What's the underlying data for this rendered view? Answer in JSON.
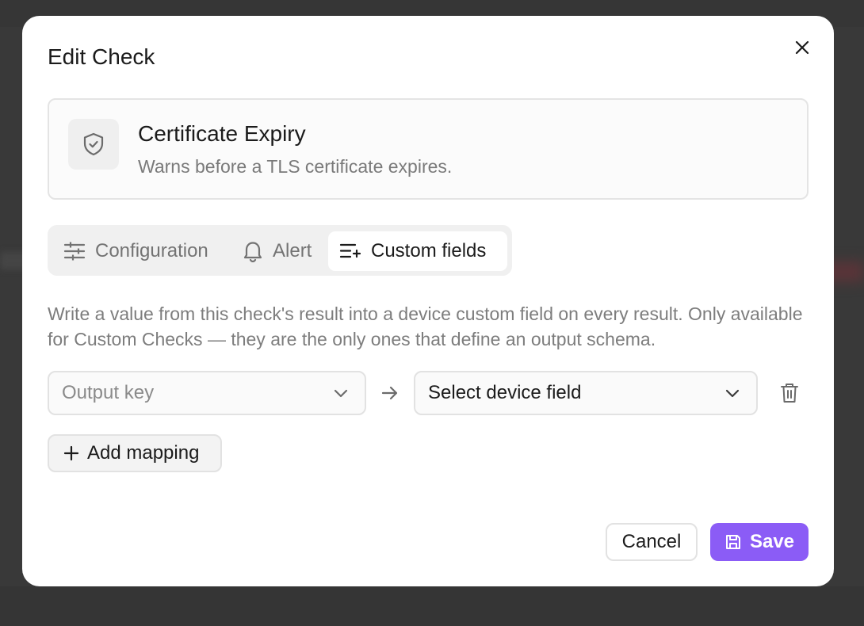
{
  "dialog": {
    "title": "Edit Check",
    "close_icon": "close-icon"
  },
  "check": {
    "icon": "shield-check-icon",
    "name": "Certificate Expiry",
    "description": "Warns before a TLS certificate expires."
  },
  "tabs": [
    {
      "label": "Configuration",
      "icon": "sliders-icon",
      "active": false
    },
    {
      "label": "Alert",
      "icon": "bell-icon",
      "active": false
    },
    {
      "label": "Custom fields",
      "icon": "list-plus-icon",
      "active": true
    }
  ],
  "custom_fields": {
    "help_text": "Write a value from this check's result into a device custom field on every result. Only available for Custom Checks — they are the only ones that define an output schema.",
    "mapping": {
      "output_key_placeholder": "Output key",
      "device_field_value": "Select device field"
    },
    "add_mapping_label": "Add mapping"
  },
  "footer": {
    "cancel_label": "Cancel",
    "save_label": "Save"
  },
  "colors": {
    "accent": "#8b5cf6",
    "backdrop": "#3a3a3a"
  }
}
